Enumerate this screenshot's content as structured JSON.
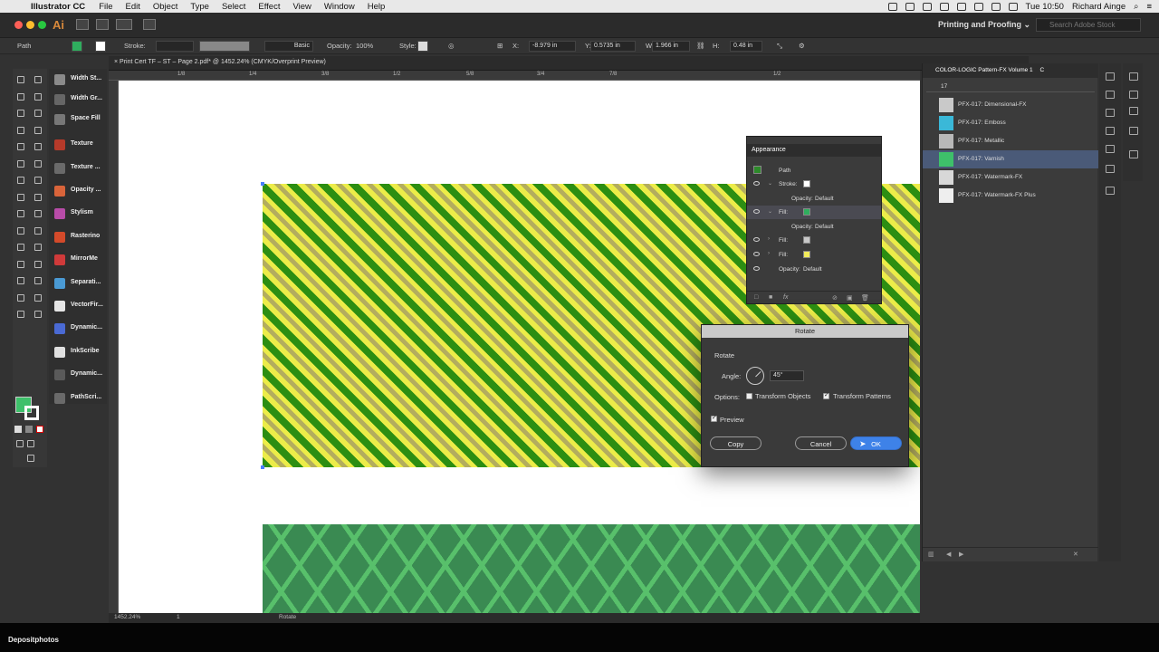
{
  "menubar": {
    "app_name": "Illustrator CC",
    "items": [
      "File",
      "Edit",
      "Object",
      "Type",
      "Select",
      "Effect",
      "View",
      "Window",
      "Help"
    ],
    "clock": "Tue 10:50",
    "user": "Richard Ainge"
  },
  "appbar": {
    "logo": "Ai",
    "workspace": "Printing and Proofing",
    "search_placeholder": "Search Adobe Stock"
  },
  "control_bar": {
    "object_type": "Path",
    "stroke_label": "Stroke:",
    "brush_label": "Basic",
    "opacity_label": "Opacity:",
    "opacity_value": "100%",
    "style_label": "Style:",
    "x_label": "X:",
    "x_value": "-8.979 in",
    "y_label": "Y:",
    "y_value": "0.5735 in",
    "w_label": "W:",
    "w_value": "1.966 in",
    "h_label": "H:",
    "h_value": "0.48 in"
  },
  "document": {
    "tab_title": "Print Cert TF – ST – Page 2.pdf* @ 1452.24% (CMYK/Overprint Preview)"
  },
  "plugins": [
    {
      "label": "Width St...",
      "color": "#8a8a8a"
    },
    {
      "label": "Width Gr...",
      "color": "#666666"
    },
    {
      "label": "Space Fill",
      "color": "#777777"
    },
    {
      "label": "Texture",
      "color": "#b63a2a"
    },
    {
      "label": "Texture ...",
      "color": "#6a6a6a"
    },
    {
      "label": "Opacity ...",
      "color": "#d9643a"
    },
    {
      "label": "Stylism",
      "color": "#b84ca8"
    },
    {
      "label": "Rasterino",
      "color": "#d44a2a"
    },
    {
      "label": "MirrorMe",
      "color": "#d03a3a"
    },
    {
      "label": "Separati...",
      "color": "#4a9ad4"
    },
    {
      "label": "VectorFir...",
      "color": "#e6e6e6"
    },
    {
      "label": "Dynamic...",
      "color": "#4a6ad4"
    },
    {
      "label": "InkScribe",
      "color": "#e0e0e0"
    },
    {
      "label": "Dynamic...",
      "color": "#5a5a5a"
    },
    {
      "label": "PathScri...",
      "color": "#6a6a6a"
    }
  ],
  "appearance": {
    "title": "Appearance",
    "path_label": "Path",
    "stroke_label": "Stroke:",
    "opacity_label": "Opacity:",
    "opacity_value": "Default",
    "fill_label": "Fill:",
    "fill_colors": [
      "#2fae5e",
      "#c8c8c8",
      "#f2ec5a"
    ]
  },
  "rotate_dialog": {
    "title": "Rotate",
    "section": "Rotate",
    "angle_label": "Angle:",
    "angle_value": "45°",
    "options_label": "Options:",
    "transform_objects": "Transform Objects",
    "transform_objects_checked": false,
    "transform_patterns": "Transform Patterns",
    "transform_patterns_checked": true,
    "preview": "Preview",
    "preview_checked": true,
    "copy_button": "Copy",
    "cancel_button": "Cancel",
    "ok_button": "OK"
  },
  "stock_panel": {
    "tab_title": "COLOR-LOGIC Pattern-FX Volume 1",
    "tab2": "C",
    "search_value": "17",
    "items": [
      {
        "label": "PFX-017: Dimensional-FX",
        "color": "#c9c9c9",
        "selected": false
      },
      {
        "label": "PFX-017: Emboss",
        "color": "#3ab8d8",
        "selected": false
      },
      {
        "label": "PFX-017: Metallic",
        "color": "#b8b8b8",
        "selected": false
      },
      {
        "label": "PFX-017: Varnish",
        "color": "#3ec06a",
        "selected": true
      },
      {
        "label": "PFX-017: Watermark-FX",
        "color": "#d8d8d8",
        "selected": false
      },
      {
        "label": "PFX-017: Watermark-FX Plus",
        "color": "#eeeeee",
        "selected": false
      }
    ]
  },
  "statusbar": {
    "zoom": "1452.24%",
    "artboard": "1",
    "tool": "Rotate"
  },
  "ruler": {
    "top_ticks": [
      "1/8",
      "1/4",
      "3/8",
      "1/2",
      "5/8",
      "3/4",
      "7/8",
      "1/2"
    ]
  },
  "watermark": "Depositphotos"
}
